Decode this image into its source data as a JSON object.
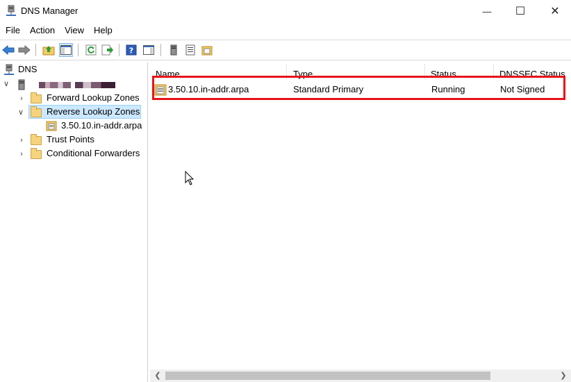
{
  "window": {
    "title": "DNS Manager",
    "controls": {
      "minimize": "—",
      "maximize": "☐",
      "close": "✕"
    }
  },
  "menu": [
    "File",
    "Action",
    "View",
    "Help"
  ],
  "toolbar": {
    "icons": [
      "back-arrow-icon",
      "forward-arrow-icon",
      "up-folder-icon",
      "show-hide-console-tree-icon",
      "refresh-icon",
      "export-list-icon",
      "help-icon",
      "action-pane-icon",
      "server-icon",
      "list-icon",
      "zone-icon"
    ]
  },
  "tree": {
    "root": "DNS",
    "server_name": "",
    "items": [
      {
        "label": "Forward Lookup Zones",
        "expanded": false
      },
      {
        "label": "Reverse Lookup Zones",
        "expanded": true,
        "selected": true
      },
      {
        "label": "3.50.10.in-addr.arpa",
        "child": true
      },
      {
        "label": "Trust Points",
        "expanded": false
      },
      {
        "label": "Conditional Forwarders",
        "expanded": false
      }
    ]
  },
  "list": {
    "columns": [
      "Name",
      "Type",
      "Status",
      "DNSSEC Status"
    ],
    "rows": [
      {
        "name": "3.50.10.in-addr.arpa",
        "type": "Standard Primary",
        "status": "Running",
        "dnssec": "Not Signed"
      }
    ]
  },
  "colors": {
    "highlight": "#e8141a",
    "selection": "#cce8ff",
    "folder": "#f6d37c"
  }
}
